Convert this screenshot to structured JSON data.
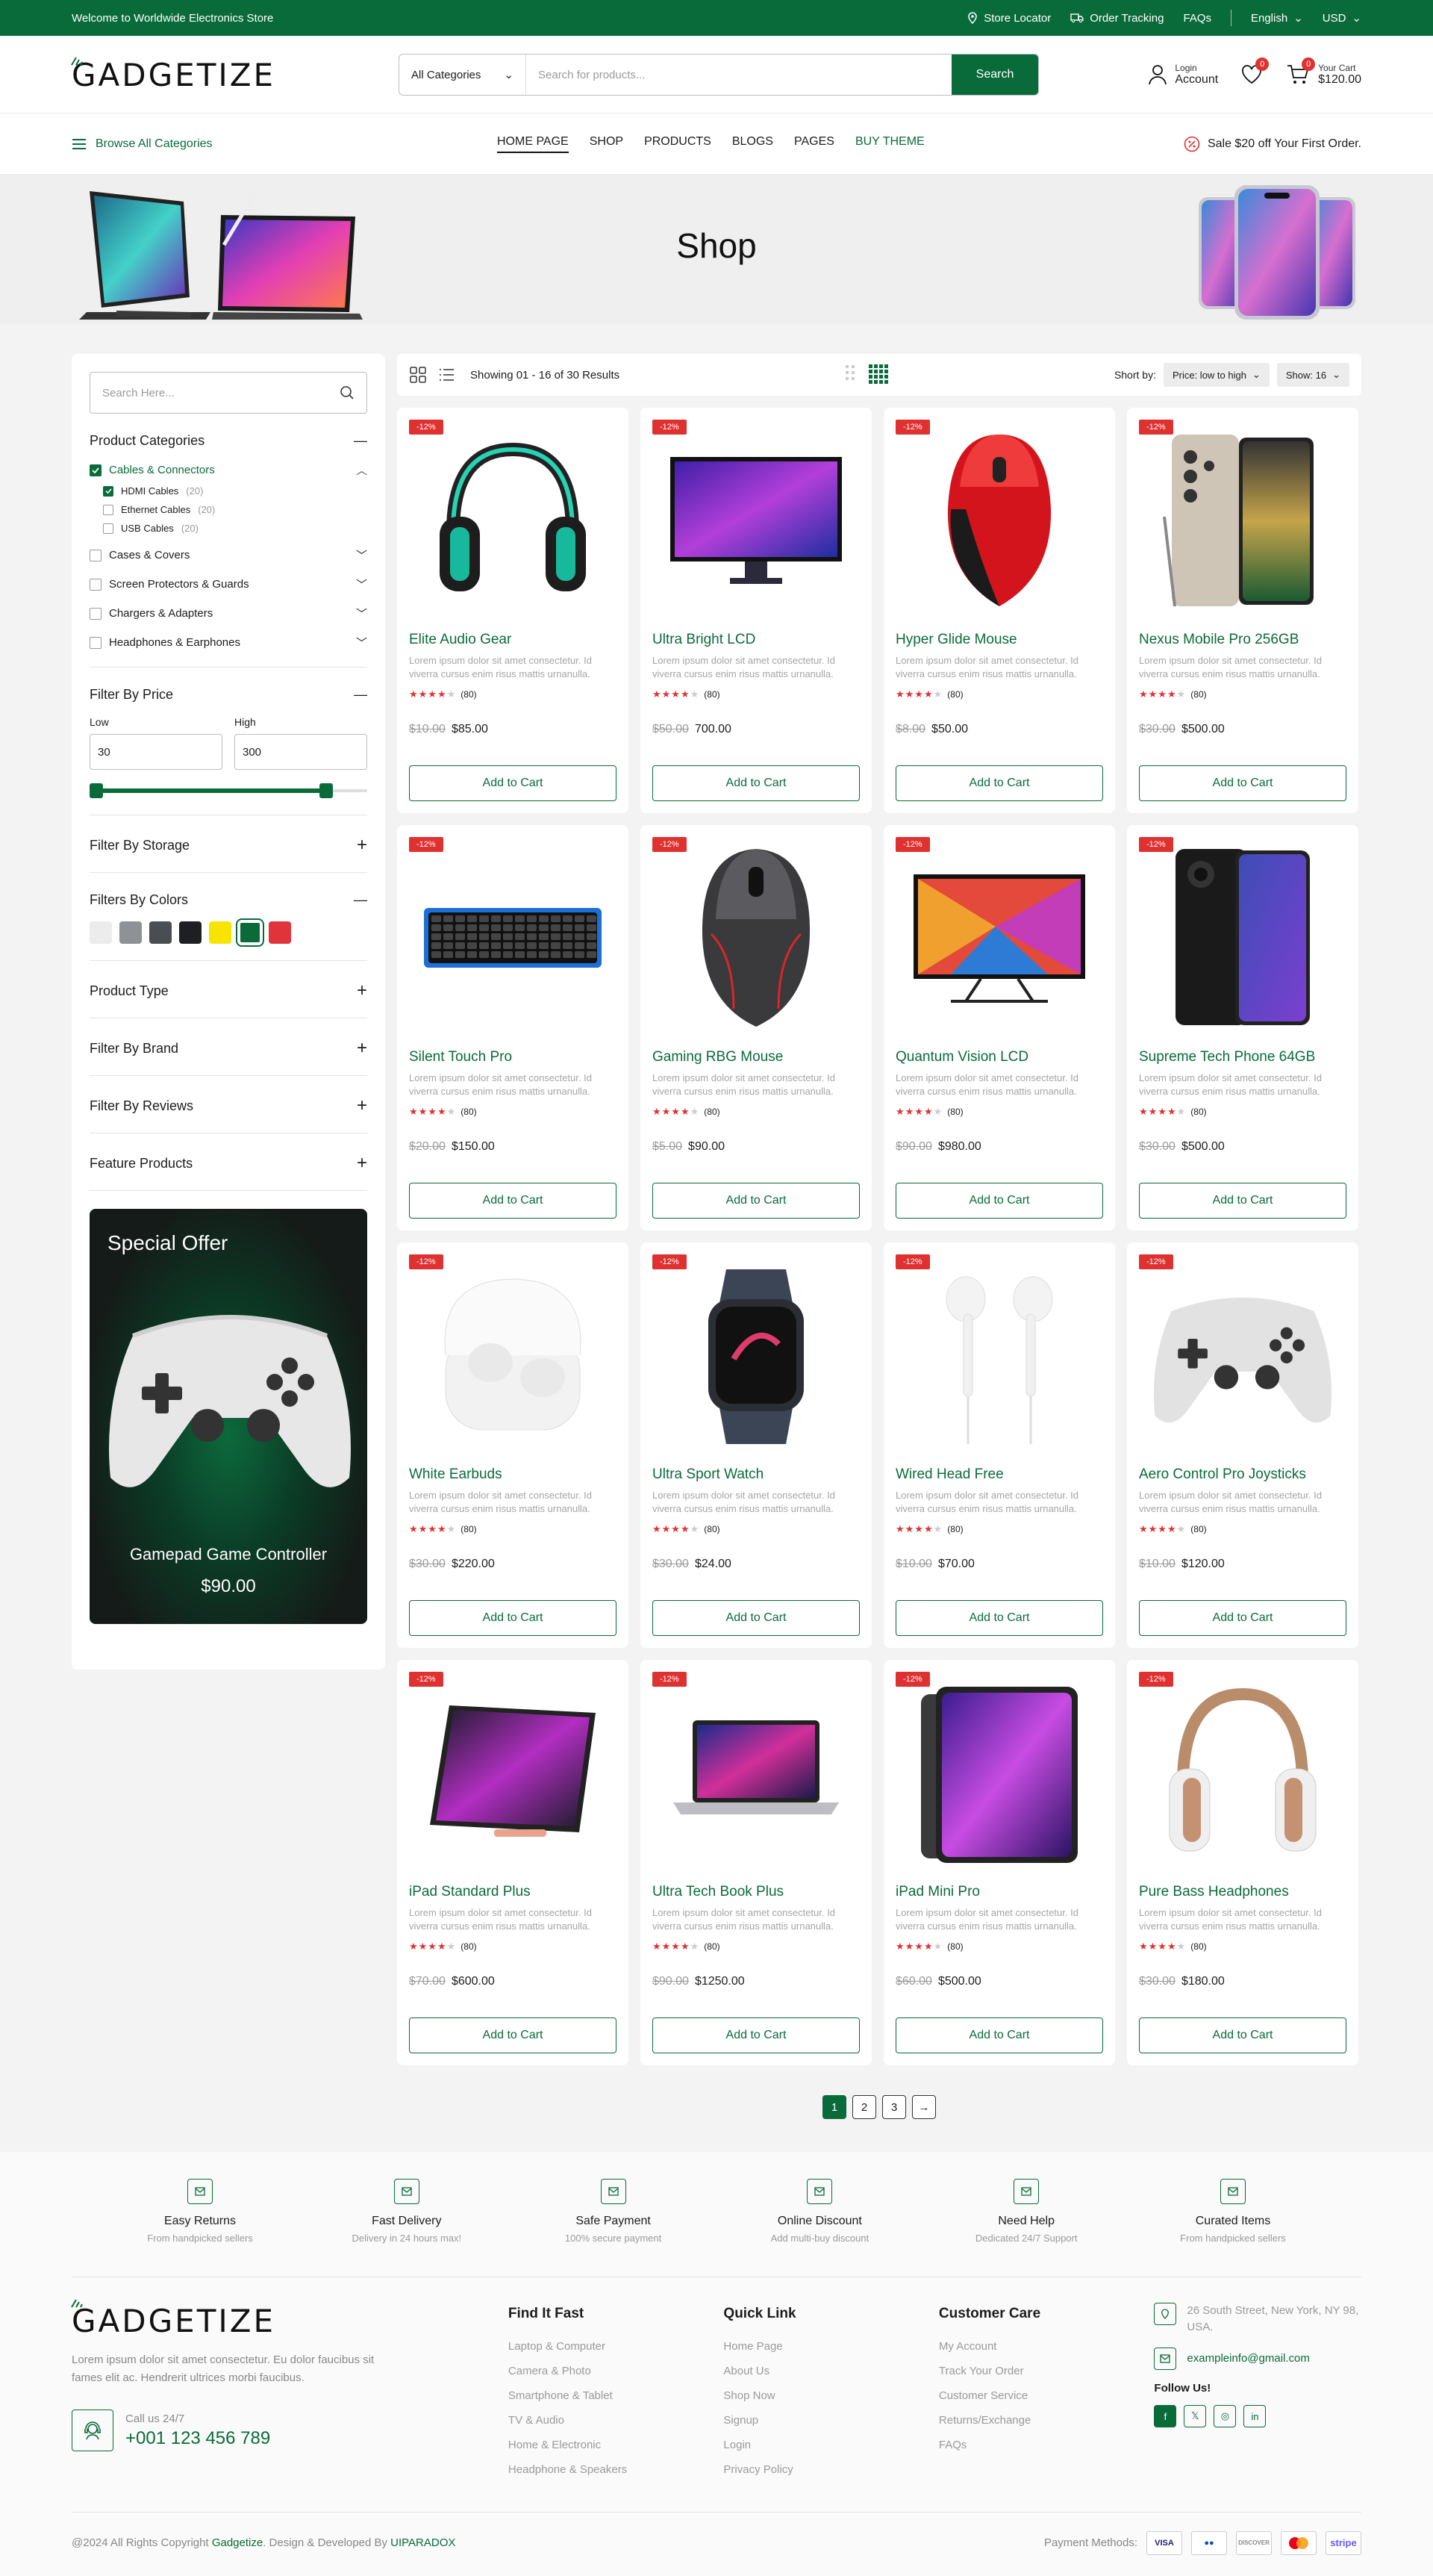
{
  "topbar": {
    "welcome": "Welcome to Worldwide Electronics Store",
    "store_locator": "Store Locator",
    "order_tracking": "Order Tracking",
    "faqs": "FAQs",
    "language": "English",
    "currency": "USD"
  },
  "header": {
    "logo": "GADGETIZE",
    "search_category": "All Categories",
    "search_placeholder": "Search for products...",
    "search_button": "Search",
    "login_label": "Login",
    "account_label": "Account",
    "wishlist_count": "0",
    "cart_count": "0",
    "cart_label": "Your Cart",
    "cart_total": "$120.00"
  },
  "nav": {
    "browse": "Browse All Categories",
    "items": [
      "HOME PAGE",
      "SHOP",
      "PRODUCTS",
      "BLOGS",
      "PAGES",
      "BUY THEME"
    ],
    "sale": "Sale $20 off Your First Order."
  },
  "hero": {
    "title": "Shop"
  },
  "sidebar": {
    "search_placeholder": "Search Here...",
    "categories_title": "Product Categories",
    "categories": [
      {
        "label": "Cables & Connectors",
        "checked": true
      },
      {
        "label": "Cases & Covers",
        "checked": false
      },
      {
        "label": "Screen Protectors & Guards",
        "checked": false
      },
      {
        "label": "Chargers & Adapters",
        "checked": false
      },
      {
        "label": "Headphones & Earphones",
        "checked": false
      }
    ],
    "subcategories": [
      {
        "label": "HDMI Cables",
        "count": "(20)",
        "checked": true
      },
      {
        "label": "Ethernet Cables",
        "count": "(20)",
        "checked": false
      },
      {
        "label": "USB Cables",
        "count": "(20)",
        "checked": false
      }
    ],
    "price_title": "Filter By Price",
    "price_low_label": "Low",
    "price_high_label": "High",
    "price_low": "30",
    "price_high": "300",
    "storage_title": "Filter By Storage",
    "colors_title": "Filters By Colors",
    "colors": [
      "#ececec",
      "#8e9196",
      "#4a4d52",
      "#1d1f22",
      "#f7e400",
      "#0a6b3a",
      "#e0333b"
    ],
    "product_type_title": "Product Type",
    "brand_title": "Filter By Brand",
    "reviews_title": "Filter By Reviews",
    "feature_title": "Feature Products",
    "offer_title": "Special Offer",
    "offer_product": "Gamepad Game Controller",
    "offer_price": "$90.00"
  },
  "toolbar": {
    "results": "Showing 01 - 16 of 30 Results",
    "sort_label": "Short by:",
    "sort_value": "Price: low to high",
    "show_value": "Show: 16"
  },
  "products": [
    {
      "name": "Elite Audio Gear",
      "old": "$10.00",
      "price": "$85.00",
      "img": "headphones-teal"
    },
    {
      "name": "Ultra Bright LCD",
      "old": "$50.00",
      "price": "700.00",
      "img": "monitor"
    },
    {
      "name": "Hyper Glide Mouse",
      "old": "$8.00",
      "price": "$50.00",
      "img": "mouse-red"
    },
    {
      "name": "Nexus Mobile Pro 256GB",
      "old": "$30.00",
      "price": "$500.00",
      "img": "phone-gold"
    },
    {
      "name": "Silent Touch Pro",
      "old": "$20.00",
      "price": "$150.00",
      "img": "keyboard"
    },
    {
      "name": "Gaming RBG Mouse",
      "old": "$5.00",
      "price": "$90.00",
      "img": "mouse-gaming"
    },
    {
      "name": "Quantum Vision LCD",
      "old": "$90.00",
      "price": "$980.00",
      "img": "monitor-art"
    },
    {
      "name": "Supreme Tech Phone 64GB",
      "old": "$30.00",
      "price": "$500.00",
      "img": "phone-black"
    },
    {
      "name": "White Earbuds",
      "old": "$30.00",
      "price": "$220.00",
      "img": "earbuds"
    },
    {
      "name": "Ultra Sport Watch",
      "old": "$30.00",
      "price": "$24.00",
      "img": "watch"
    },
    {
      "name": "Wired Head Free",
      "old": "$10.00",
      "price": "$70.00",
      "img": "earphones"
    },
    {
      "name": "Aero Control Pro Joysticks",
      "old": "$10.00",
      "price": "$120.00",
      "img": "gamepad"
    },
    {
      "name": "iPad Standard Plus",
      "old": "$70.00",
      "price": "$600.00",
      "img": "tablet"
    },
    {
      "name": "Ultra Tech Book Plus",
      "old": "$90.00",
      "price": "$1250.00",
      "img": "laptop"
    },
    {
      "name": "iPad Mini Pro",
      "old": "$60.00",
      "price": "$500.00",
      "img": "ipad"
    },
    {
      "name": "Pure Bass Headphones",
      "old": "$30.00",
      "price": "$180.00",
      "img": "headphones-rose"
    }
  ],
  "product_common": {
    "discount": "-12%",
    "desc": "Lorem ipsum dolor sit amet consectetur. Id viverra cursus enim risus mattis urnanulla.",
    "stars": "★★★★★",
    "reviews": "(80)",
    "cart_label": "Add to Cart"
  },
  "pagination": [
    "1",
    "2",
    "3",
    "→"
  ],
  "features": [
    {
      "title": "Easy Returns",
      "desc": "From handpicked sellers"
    },
    {
      "title": "Fast Delivery",
      "desc": "Delivery in 24 hours max!"
    },
    {
      "title": "Safe Payment",
      "desc": "100% secure payment"
    },
    {
      "title": "Online Discount",
      "desc": "Add multi-buy discount"
    },
    {
      "title": "Need Help",
      "desc": "Dedicated 24/7 Support"
    },
    {
      "title": "Curated Items",
      "desc": "From handpicked sellers"
    }
  ],
  "footer": {
    "about": "Lorem ipsum dolor sit amet consectetur. Eu dolor faucibus sit fames elit ac. Hendrerit ultrices morbi faucibus.",
    "call_label": "Call us 24/7",
    "phone": "+001 123 456 789",
    "col1_title": "Find It Fast",
    "col1": [
      "Laptop & Computer",
      "Camera & Photo",
      "Smartphone & Tablet",
      "TV & Audio",
      "Home & Electronic",
      "Headphone & Speakers"
    ],
    "col2_title": "Quick Link",
    "col2": [
      "Home Page",
      "About Us",
      "Shop Now",
      "Signup",
      "Login",
      "Privacy Policy"
    ],
    "col3_title": "Customer Care",
    "col3": [
      "My Account",
      "Track Your Order",
      "Customer Service",
      "Returns/Exchange",
      "FAQs"
    ],
    "address": "26 South Street, New York, NY 98, USA.",
    "email": "exampleinfo@gmail.com",
    "follow": "Follow Us!",
    "social": [
      "f",
      "𝕏",
      "◎",
      "in"
    ],
    "copy_prefix": "@2024 All Rights Copyright",
    "copy_brand": "Gadgetize",
    "copy_mid": ". Design & Developed By",
    "copy_dev": "UIPARADOX",
    "payment_label": "Payment Methods:",
    "payments": [
      "VISA",
      "●●",
      "DISCOVER",
      "●●",
      "stripe"
    ]
  }
}
